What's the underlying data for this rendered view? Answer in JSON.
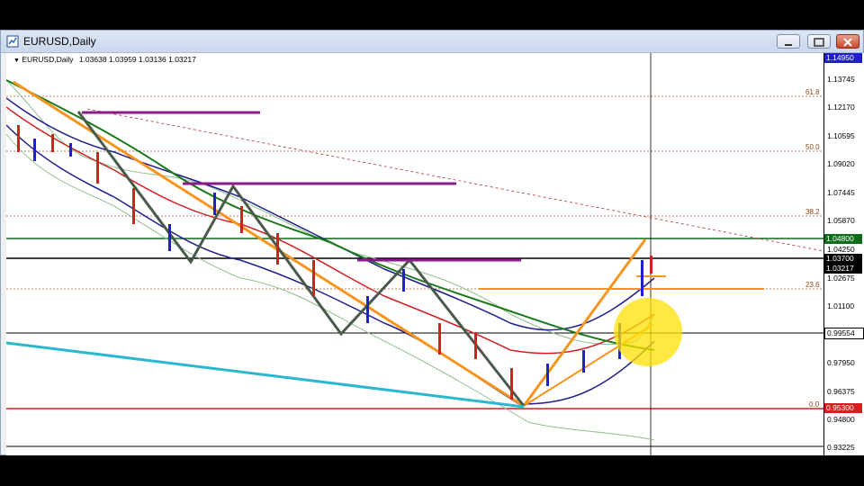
{
  "window": {
    "title": "EURUSD,Daily"
  },
  "chart_info": {
    "symbol_line": "EURUSD,Daily",
    "ohlc": "1.03638 1.03959 1.03136 1.03217"
  },
  "fib_levels": [
    "61.8",
    "50.0",
    "38.2",
    "23.6",
    "0.0"
  ],
  "price_axis": {
    "ticks": [
      "1.13745",
      "1.12170",
      "1.10595",
      "1.09020",
      "1.07445",
      "1.05870",
      "1.04250",
      "1.02675",
      "1.01100",
      "0.97950",
      "0.96375",
      "0.94800",
      "0.93225"
    ],
    "boxes": [
      {
        "label": "1.14950",
        "color": "#1f1fd0"
      },
      {
        "label": "1.04800",
        "color": "#0f6b1a"
      },
      {
        "label": "1.03700",
        "color": "#000000"
      },
      {
        "label": "1.03217",
        "color": "#000000"
      },
      {
        "label": "0.99554",
        "color": "#ffffff"
      },
      {
        "label": "0.95300",
        "color": "#d02020"
      }
    ]
  },
  "colors": {
    "trend_orange": "#f7941d",
    "zigzag_dark": "#4a5a4a",
    "purple_line": "#8b1a8b",
    "cyan_line": "#2ab8d0",
    "green_ma": "#1a7a1a",
    "red_ma": "#d02020",
    "blue_band": "#1f1f8b",
    "highlight_circle": "#ffe000"
  }
}
